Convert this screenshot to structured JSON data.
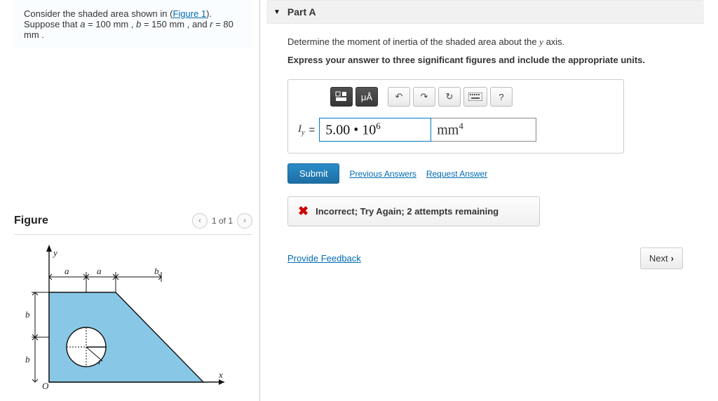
{
  "prompt": {
    "pre": "Consider the shaded area shown in (",
    "figure_link": "Figure 1",
    "post": "). Suppose that ",
    "eq_a_var": "a",
    "eq_a_val": " = 100  mm , ",
    "eq_b_var": "b",
    "eq_b_val": " = 150  mm , and ",
    "eq_r_var": "r",
    "eq_r_val": " = 80  mm ."
  },
  "figure": {
    "title": "Figure",
    "counter": "1 of 1",
    "labels": {
      "y": "y",
      "x": "x",
      "O": "O",
      "a": "a",
      "b": "b",
      "r": "r"
    }
  },
  "part": {
    "label": "Part A",
    "instruction1_pre": "Determine the moment of inertia of the shaded area about the ",
    "instruction1_var": "y",
    "instruction1_post": " axis.",
    "instruction2": "Express your answer to three significant figures and include the appropriate units.",
    "toolbar": {
      "templates_icon": "templates-icon",
      "units_label": "μÅ",
      "undo_icon": "undo-icon",
      "redo_icon": "redo-icon",
      "reset_icon": "reset-icon",
      "keyboard_icon": "keyboard-icon",
      "help_label": "?"
    },
    "answer": {
      "symbol": "I",
      "subscript": "y",
      "equals": "=",
      "value_html": "5.00 • 10<sup style='font-size:13px'>6</sup>",
      "units_html": "mm<sup style='font-size:13px'>4</sup>"
    },
    "actions": {
      "submit": "Submit",
      "previous": "Previous Answers",
      "request": "Request Answer"
    },
    "feedback": "Incorrect; Try Again; 2 attempts remaining"
  },
  "footer": {
    "provide_feedback": "Provide Feedback",
    "next": "Next"
  }
}
